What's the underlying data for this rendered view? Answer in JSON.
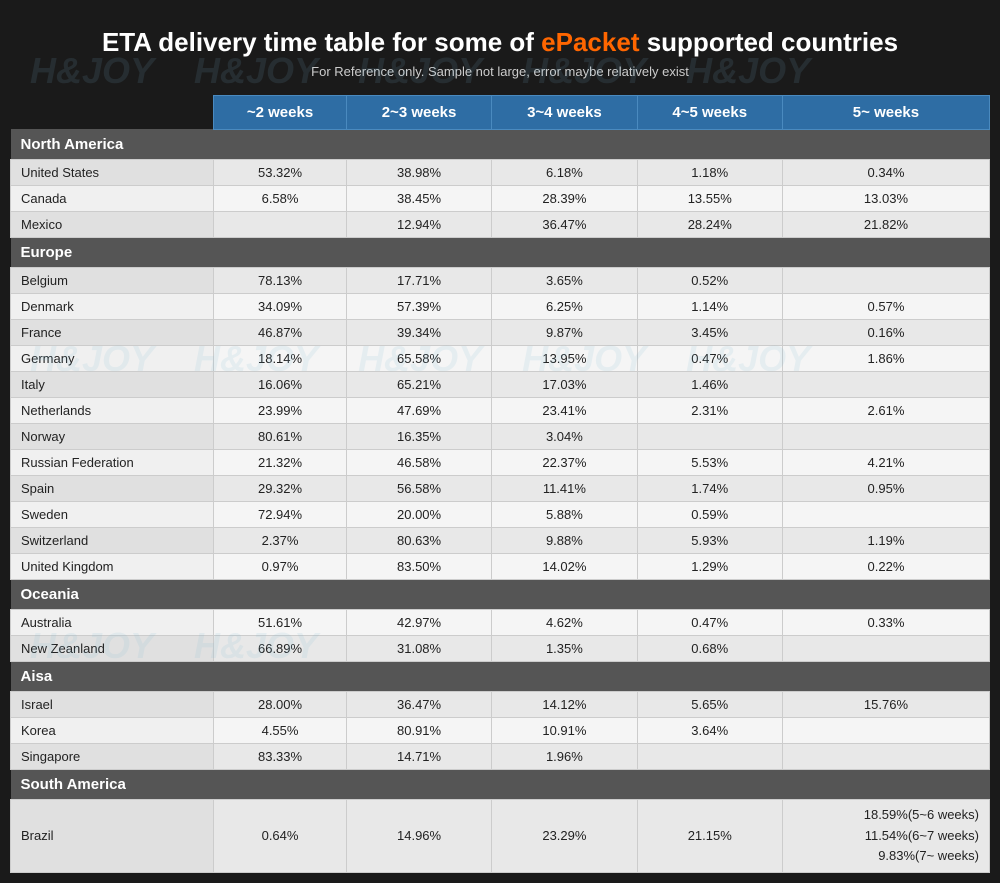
{
  "title": {
    "main_prefix": "ETA delivery time table for some of ",
    "highlight": "ePacket",
    "main_suffix": " supported countries",
    "subtitle": "For Reference only. Sample not large, error maybe relatively exist"
  },
  "watermark": "H&JOY",
  "columns": [
    "",
    "~2 weeks",
    "2~3 weeks",
    "3~4 weeks",
    "4~5 weeks",
    "5~ weeks"
  ],
  "sections": [
    {
      "name": "North America",
      "rows": [
        {
          "country": "United States",
          "w2": "53.32%",
          "w23": "38.98%",
          "w34": "6.18%",
          "w45": "1.18%",
          "w5": "0.34%"
        },
        {
          "country": "Canada",
          "w2": "6.58%",
          "w23": "38.45%",
          "w34": "28.39%",
          "w45": "13.55%",
          "w5": "13.03%"
        },
        {
          "country": "Mexico",
          "w2": "",
          "w23": "12.94%",
          "w34": "36.47%",
          "w45": "28.24%",
          "w5": "21.82%"
        }
      ]
    },
    {
      "name": "Europe",
      "rows": [
        {
          "country": "Belgium",
          "w2": "78.13%",
          "w23": "17.71%",
          "w34": "3.65%",
          "w45": "0.52%",
          "w5": ""
        },
        {
          "country": "Denmark",
          "w2": "34.09%",
          "w23": "57.39%",
          "w34": "6.25%",
          "w45": "1.14%",
          "w5": "0.57%"
        },
        {
          "country": "France",
          "w2": "46.87%",
          "w23": "39.34%",
          "w34": "9.87%",
          "w45": "3.45%",
          "w5": "0.16%"
        },
        {
          "country": "Germany",
          "w2": "18.14%",
          "w23": "65.58%",
          "w34": "13.95%",
          "w45": "0.47%",
          "w5": "1.86%"
        },
        {
          "country": "Italy",
          "w2": "16.06%",
          "w23": "65.21%",
          "w34": "17.03%",
          "w45": "1.46%",
          "w5": ""
        },
        {
          "country": "Netherlands",
          "w2": "23.99%",
          "w23": "47.69%",
          "w34": "23.41%",
          "w45": "2.31%",
          "w5": "2.61%"
        },
        {
          "country": "Norway",
          "w2": "80.61%",
          "w23": "16.35%",
          "w34": "3.04%",
          "w45": "",
          "w5": ""
        },
        {
          "country": "Russian Federation",
          "w2": "21.32%",
          "w23": "46.58%",
          "w34": "22.37%",
          "w45": "5.53%",
          "w5": "4.21%"
        },
        {
          "country": "Spain",
          "w2": "29.32%",
          "w23": "56.58%",
          "w34": "11.41%",
          "w45": "1.74%",
          "w5": "0.95%"
        },
        {
          "country": "Sweden",
          "w2": "72.94%",
          "w23": "20.00%",
          "w34": "5.88%",
          "w45": "0.59%",
          "w5": ""
        },
        {
          "country": "Switzerland",
          "w2": "2.37%",
          "w23": "80.63%",
          "w34": "9.88%",
          "w45": "5.93%",
          "w5": "1.19%"
        },
        {
          "country": "United Kingdom",
          "w2": "0.97%",
          "w23": "83.50%",
          "w34": "14.02%",
          "w45": "1.29%",
          "w5": "0.22%"
        }
      ]
    },
    {
      "name": "Oceania",
      "rows": [
        {
          "country": "Australia",
          "w2": "51.61%",
          "w23": "42.97%",
          "w34": "4.62%",
          "w45": "0.47%",
          "w5": "0.33%"
        },
        {
          "country": "New Zeanland",
          "w2": "66.89%",
          "w23": "31.08%",
          "w34": "1.35%",
          "w45": "0.68%",
          "w5": ""
        }
      ]
    },
    {
      "name": "Aisa",
      "rows": [
        {
          "country": "Israel",
          "w2": "28.00%",
          "w23": "36.47%",
          "w34": "14.12%",
          "w45": "5.65%",
          "w5": "15.76%"
        },
        {
          "country": "Korea",
          "w2": "4.55%",
          "w23": "80.91%",
          "w34": "10.91%",
          "w45": "3.64%",
          "w5": ""
        },
        {
          "country": "Singapore",
          "w2": "83.33%",
          "w23": "14.71%",
          "w34": "1.96%",
          "w45": "",
          "w5": ""
        }
      ]
    },
    {
      "name": "South America",
      "rows": [
        {
          "country": "Brazil",
          "w2": "0.64%",
          "w23": "14.96%",
          "w34": "23.29%",
          "w45": "21.15%",
          "w5": "18.59%(5~6 weeks)\n11.54%(6~7 weeks)\n9.83%(7~ weeks)"
        }
      ]
    }
  ]
}
